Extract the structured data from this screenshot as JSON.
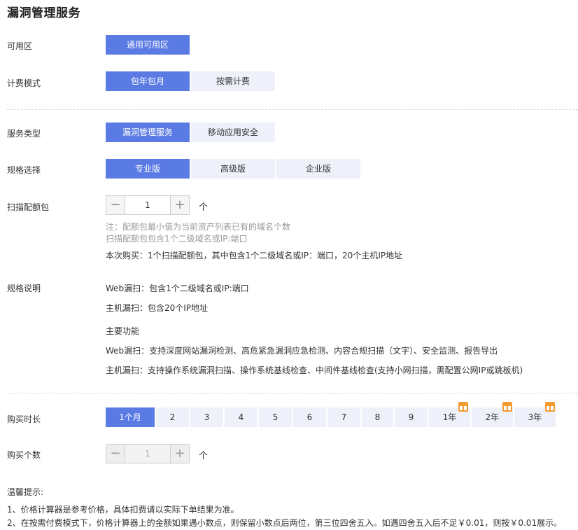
{
  "page": {
    "title": "漏洞管理服务"
  },
  "availability_zone": {
    "label": "可用区",
    "options": [
      "通用可用区"
    ],
    "selected": 0
  },
  "billing_mode": {
    "label": "计费模式",
    "options": [
      "包年包月",
      "按需计费"
    ],
    "selected": 0
  },
  "service_type": {
    "label": "服务类型",
    "options": [
      "漏洞管理服务",
      "移动应用安全"
    ],
    "selected": 0
  },
  "spec": {
    "label": "规格选择",
    "options": [
      "专业版",
      "高级版",
      "企业版"
    ],
    "selected": 0
  },
  "scan_package": {
    "label": "扫描配额包",
    "value": "1",
    "unit": "个",
    "note_1": "注：配额包最小值为当前资产列表已有的域名个数",
    "note_2": "扫描配额包包含1个二级域名或IP:端口",
    "purchase_info": "本次购买：1个扫描配额包，其中包含1个二级域名或IP：端口，20个主机IP地址"
  },
  "spec_description": {
    "label": "规格说明",
    "web_scan": "Web漏扫：包含1个二级域名或IP:端口",
    "host_scan": "主机漏扫：包含20个IP地址",
    "features_title": "主要功能",
    "web_features": "Web漏扫：支持深度网站漏洞检测、高危紧急漏洞应急检测、内容合规扫描（文字）、安全监测、报告导出",
    "host_features": "主机漏扫：支持操作系统漏洞扫描、操作系统基线检查、中间件基线检查(支持小网扫描，需配置公网IP或跳板机)"
  },
  "duration": {
    "label": "购买时长",
    "options": [
      "1个月",
      "2",
      "3",
      "4",
      "5",
      "6",
      "7",
      "8",
      "9",
      "1年",
      "2年",
      "3年"
    ],
    "selected": 0,
    "gift_icon_on": [
      "1年",
      "2年",
      "3年"
    ]
  },
  "quantity": {
    "label": "购买个数",
    "value": "1",
    "unit": "个"
  },
  "tips": {
    "title": "温馨提示:",
    "items": [
      "1、价格计算器是参考价格，具体扣费请以实际下单结果为准。",
      "2、在按需付费模式下，价格计算器上的金额如果遇小数点，则保留小数点后两位，第三位四舍五入。如遇四舍五入后不足￥0.01，则按￥0.01展示。"
    ]
  },
  "colors": {
    "accent": "#5b7be4",
    "inactive_bg": "#eef0fa",
    "gift": "#f39b2e",
    "note": "#999999"
  }
}
